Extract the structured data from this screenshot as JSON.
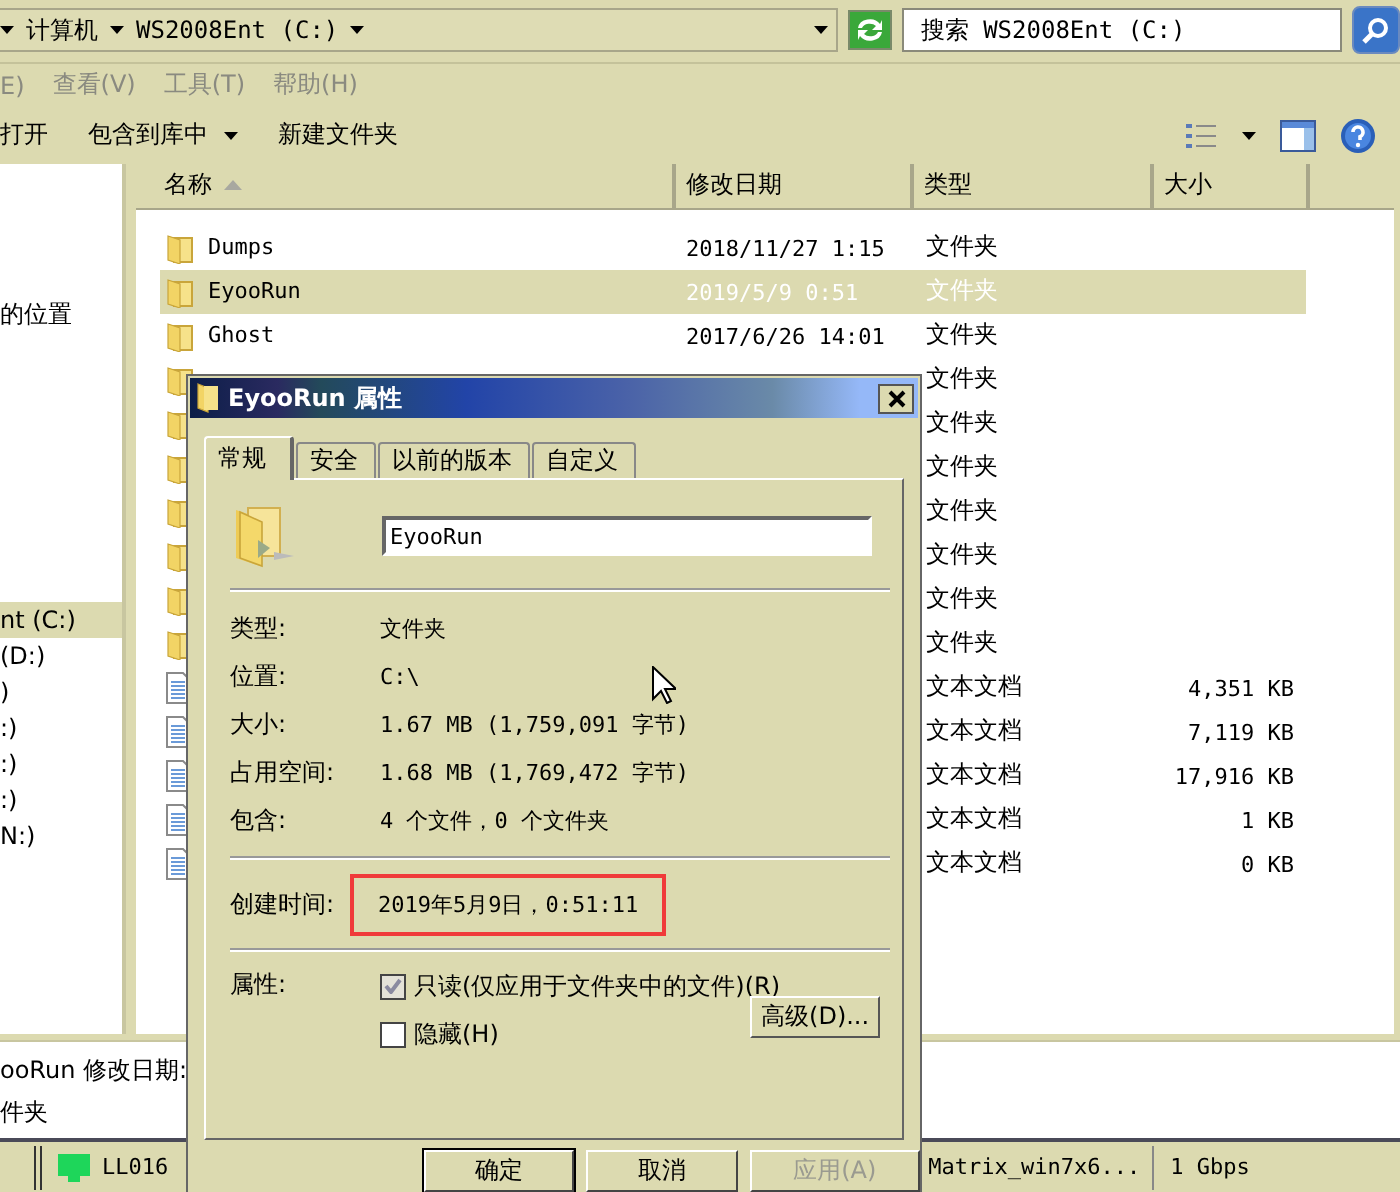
{
  "address_bar": {
    "breadcrumbs": [
      "计算机",
      "WS2008Ent (C:)"
    ],
    "search": {
      "placeholder": "搜索 WS2008Ent (C:)"
    }
  },
  "menu": [
    {
      "label": "E)",
      "disabled": true
    },
    {
      "label": "查看(V)",
      "disabled": true
    },
    {
      "label": "工具(T)",
      "disabled": true
    },
    {
      "label": "帮助(H)",
      "disabled": true
    }
  ],
  "toolbar": [
    {
      "label": "打开",
      "dropdown": false
    },
    {
      "label": "包含到库中",
      "dropdown": true
    },
    {
      "label": "新建文件夹",
      "dropdown": false
    }
  ],
  "navigation": {
    "groups": [
      {
        "items": [
          {
            "label": "的位置",
            "selected": false
          }
        ]
      },
      {
        "items": [
          {
            "label": "nt (C:)",
            "selected": true
          },
          {
            "label": "(D:)",
            "selected": false
          },
          {
            "label": ")",
            "selected": false
          },
          {
            "label": ":)",
            "selected": false
          },
          {
            "label": ":)",
            "selected": false
          },
          {
            "label": ":)",
            "selected": false
          },
          {
            "label": "N:)",
            "selected": false
          }
        ]
      }
    ]
  },
  "file_list": {
    "columns": [
      {
        "label": "名称",
        "sorted": true
      },
      {
        "label": "修改日期",
        "sorted": false
      },
      {
        "label": "类型",
        "sorted": false
      },
      {
        "label": "大小",
        "sorted": false
      }
    ],
    "rows": [
      {
        "kind": "folder",
        "name": "Dumps",
        "modified": "2018/11/27 1:15",
        "type": "文件夹",
        "selected": false
      },
      {
        "kind": "folder",
        "name": "EyooRun",
        "modified": "2019/5/9 0:51",
        "type": "文件夹",
        "selected": true
      },
      {
        "kind": "folder",
        "name": "Ghost",
        "modified": "2017/6/26 14:01",
        "type": "文件夹",
        "selected": false
      },
      {
        "kind": "folder",
        "type": "文件夹",
        "selected": false
      },
      {
        "kind": "folder",
        "type": "文件夹",
        "selected": false
      },
      {
        "kind": "folder",
        "type": "文件夹",
        "selected": false
      },
      {
        "kind": "folder",
        "type": "文件夹",
        "selected": false
      },
      {
        "kind": "folder",
        "type": "文件夹",
        "selected": false
      },
      {
        "kind": "folder",
        "type": "文件夹",
        "selected": false
      },
      {
        "kind": "folder",
        "type": "文件夹",
        "selected": false
      },
      {
        "kind": "text",
        "type": "文本文档",
        "size": "4,351 KB",
        "selected": false
      },
      {
        "kind": "text",
        "type": "文本文档",
        "size": "7,119 KB",
        "selected": false
      },
      {
        "kind": "text",
        "type": "文本文档",
        "size": "17,916 KB",
        "selected": false
      },
      {
        "kind": "text",
        "type": "文本文档",
        "size": "1 KB",
        "selected": false
      },
      {
        "kind": "text",
        "type": "文本文档",
        "size": "0 KB",
        "selected": false
      }
    ]
  },
  "details_pane": {
    "lines": [
      "ooRun 修改日期:",
      "件夹"
    ]
  },
  "status_bar": {
    "items": [
      "LL016",
      "Matrix_win7x6...",
      "1 Gbps"
    ]
  },
  "dialog": {
    "title": "EyooRun 属性",
    "tabs": [
      {
        "label": "常规",
        "selected": true
      },
      {
        "label": "安全",
        "selected": false
      },
      {
        "label": "以前的版本",
        "selected": false
      },
      {
        "label": "自定义",
        "selected": false
      }
    ],
    "name_field": {
      "value": "EyooRun"
    },
    "properties": [
      {
        "label": "类型:",
        "value": "文件夹"
      },
      {
        "label": "位置:",
        "value": "C:\\"
      },
      {
        "label": "大小:",
        "value": "1.67 MB (1,759,091 字节)"
      },
      {
        "label": "占用空间:",
        "value": "1.68 MB (1,769,472 字节)"
      },
      {
        "label": "包含:",
        "value": "4 个文件，0 个文件夹"
      }
    ],
    "created": {
      "label": "创建时间:",
      "value": "2019年5月9日，0:51:11",
      "highlighted": true
    },
    "attributes": {
      "label": "属性:",
      "options": [
        {
          "label": "只读(仅应用于文件夹中的文件)(R)",
          "checked": true
        },
        {
          "label": "隐藏(H)",
          "checked": false
        }
      ],
      "advanced_button": "高级(D)..."
    },
    "buttons": [
      {
        "label": "确定",
        "disabled": false
      },
      {
        "label": "取消",
        "disabled": false
      },
      {
        "label": "应用(A)",
        "disabled": true
      }
    ]
  }
}
